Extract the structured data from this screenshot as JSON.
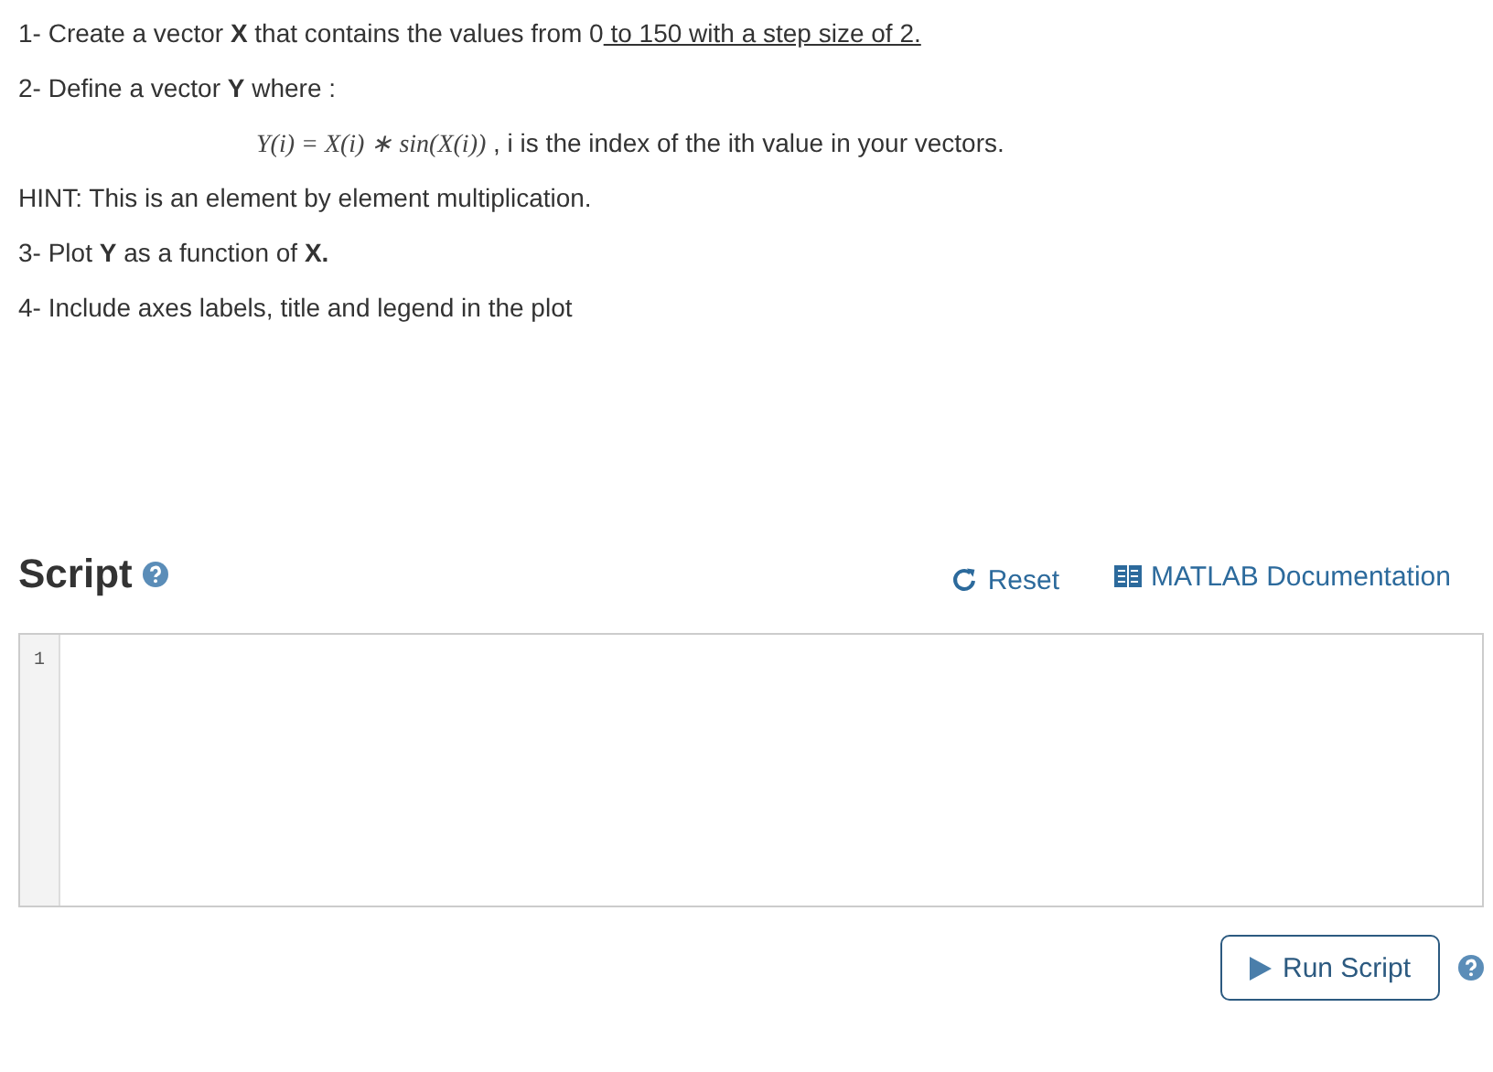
{
  "instructions": [
    {
      "kind": "step",
      "text": "1- Create a vector **X** that contains the values from 0",
      "underlined": " to 150 with a step size of 2."
    },
    {
      "kind": "step",
      "text": "2- Define a vector **Y** where :"
    },
    {
      "kind": "formula",
      "formula": "Y(i) = X(i) ∗ sin(X(i))",
      "text": " , i is the index of the ith value in your vectors."
    },
    {
      "kind": "step",
      "text": "HINT: This is an element by element multiplication."
    },
    {
      "kind": "step",
      "text": "3- Plot **Y** as a function of **X.**"
    },
    {
      "kind": "step",
      "text": "4- Include axes labels, title and legend in the plot"
    }
  ],
  "script": {
    "title": "Script",
    "reset": "Reset",
    "documentation": "MATLAB Documentation",
    "line_numbers": [
      "1"
    ],
    "run_button": "Run Script"
  }
}
